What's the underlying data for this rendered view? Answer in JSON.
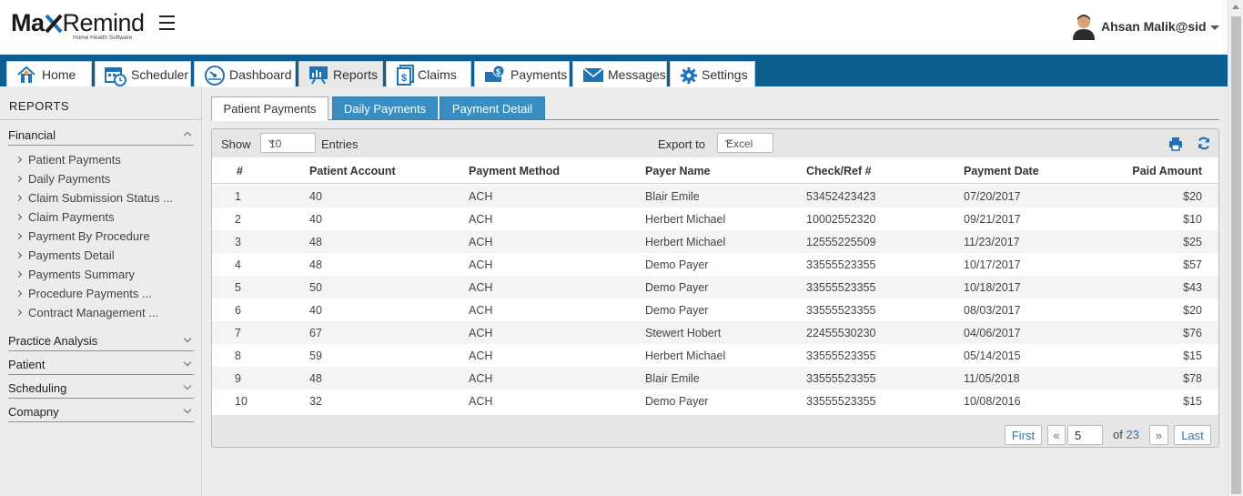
{
  "app": {
    "logo_text": "MaxRemind",
    "logo_sub": "Home Health Software"
  },
  "user": {
    "name": "Ahsan Malik@sid"
  },
  "nav": {
    "tabs": [
      {
        "label": "Home",
        "icon": "home-icon"
      },
      {
        "label": "Scheduler",
        "icon": "calendar-icon"
      },
      {
        "label": "Dashboard",
        "icon": "speedometer-icon"
      },
      {
        "label": "Reports",
        "icon": "report-icon",
        "active": true
      },
      {
        "label": "Claims",
        "icon": "claims-icon"
      },
      {
        "label": "Payments",
        "icon": "payments-icon"
      },
      {
        "label": "Messages",
        "icon": "envelope-icon"
      },
      {
        "label": "Settings",
        "icon": "gear-icon"
      }
    ]
  },
  "sidebar": {
    "title": "REPORTS",
    "sections": [
      {
        "label": "Financial",
        "expanded": true,
        "items": [
          "Patient Payments",
          "Daily Payments",
          "Claim Submission Status ...",
          "Claim Payments",
          "Payment By Procedure",
          "Payments Detail",
          "Payments Summary",
          "Procedure Payments ...",
          "Contract Management ..."
        ]
      },
      {
        "label": "Practice Analysis"
      },
      {
        "label": "Patient"
      },
      {
        "label": "Scheduling"
      },
      {
        "label": "Comapny"
      }
    ]
  },
  "report_tabs": [
    {
      "label": "Patient Payments",
      "active": true
    },
    {
      "label": "Daily Payments"
    },
    {
      "label": "Payment Detail"
    }
  ],
  "toolbar": {
    "show_label": "Show",
    "page_size": "10",
    "entries_label": "Entries",
    "export_label": "Export to",
    "export_value": "Excel"
  },
  "table": {
    "columns": [
      "#",
      "Patient Account",
      "Payment Method",
      "Payer Name",
      "Check/Ref #",
      "Payment Date",
      "Paid Amount"
    ],
    "rows": [
      [
        "1",
        "40",
        "ACH",
        "Blair Emile",
        "53452423423",
        "07/20/2017",
        "$20"
      ],
      [
        "2",
        "40",
        "ACH",
        "Herbert Michael",
        "10002552320",
        "09/21/2017",
        "$10"
      ],
      [
        "3",
        "48",
        "ACH",
        "Herbert Michael",
        "12555225509",
        "11/23/2017",
        "$25"
      ],
      [
        "4",
        "48",
        "ACH",
        "Demo Payer",
        "33555523355",
        "10/17/2017",
        "$57"
      ],
      [
        "5",
        "50",
        "ACH",
        "Demo Payer",
        "33555523355",
        "10/18/2017",
        "$43"
      ],
      [
        "6",
        "40",
        "ACH",
        "Demo Payer",
        "33555523355",
        "08/03/2017",
        "$20"
      ],
      [
        "7",
        "67",
        "ACH",
        "Stewert Hobert",
        "22455530230",
        "04/06/2017",
        "$76"
      ],
      [
        "8",
        "59",
        "ACH",
        "Herbert Michael",
        "33555523355",
        "05/14/2015",
        "$15"
      ],
      [
        "9",
        "48",
        "ACH",
        "Blair Emile",
        "33555523355",
        "11/05/2018",
        "$78"
      ],
      [
        "10",
        "32",
        "ACH",
        "Demo Payer",
        "33555523355",
        "10/08/2016",
        "$15"
      ]
    ]
  },
  "pagination": {
    "first": "First",
    "prev": "«",
    "current": "5",
    "of_label": "of",
    "total": "23",
    "next": "»",
    "last": "Last"
  },
  "colors": {
    "nav_bg": "#0b5e8f",
    "tab_inactive": "#3a8dc0",
    "link": "#3a6fa0",
    "section_border": "#5aa0cc"
  }
}
